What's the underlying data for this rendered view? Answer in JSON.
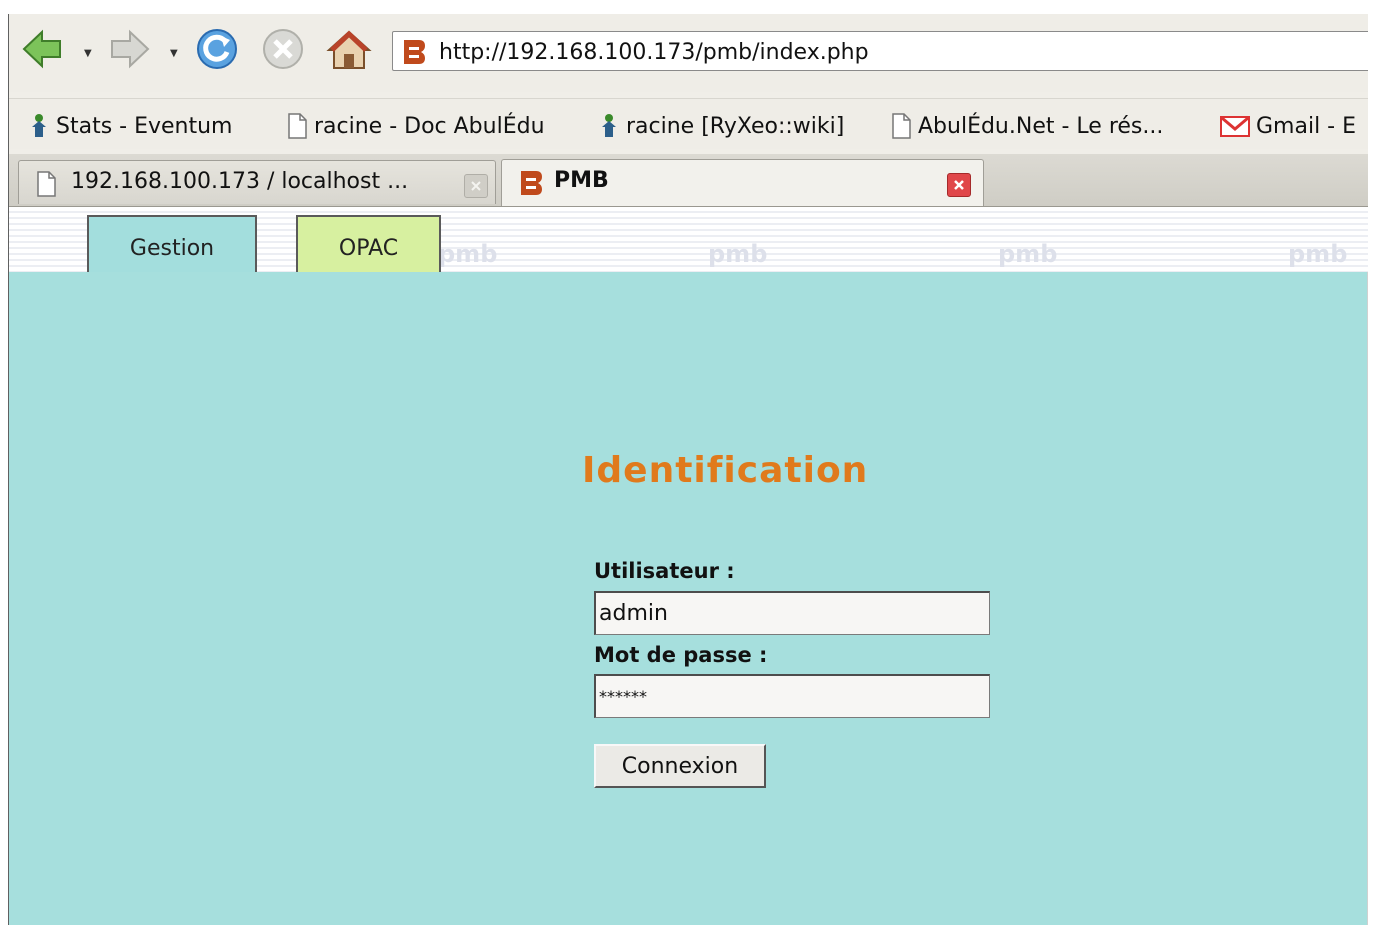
{
  "browser": {
    "url": "http://192.168.100.173/pmb/index.php",
    "bookmarks": [
      {
        "label": "Stats - Eventum",
        "icon": "tree-people-icon"
      },
      {
        "label": "racine - Doc AbulÉdu",
        "icon": "page-icon"
      },
      {
        "label": "racine [RyXeo::wiki]",
        "icon": "tree-people-icon"
      },
      {
        "label": "AbulÉdu.Net - Le rés...",
        "icon": "page-icon"
      },
      {
        "label": "Gmail - E",
        "icon": "gmail-icon"
      }
    ],
    "tabs": [
      {
        "label": "192.168.100.173 / localhost ...",
        "icon": "page-icon",
        "active": false
      },
      {
        "label": "PMB",
        "icon": "pmb-icon",
        "active": true
      }
    ]
  },
  "app": {
    "tabs": [
      {
        "label": "Gestion",
        "active": true
      },
      {
        "label": "OPAC",
        "active": false
      }
    ],
    "watermark": "pmb",
    "login": {
      "title": "Identification",
      "user_label": "Utilisateur :",
      "user_value": "admin",
      "password_label": "Mot de passe :",
      "password_value": "******",
      "submit_label": "Connexion"
    }
  },
  "colors": {
    "content_bg": "#a6dfdd",
    "gestion_tab": "#a3dedd",
    "opac_tab": "#d7f0a0",
    "title": "#e07a1c"
  }
}
